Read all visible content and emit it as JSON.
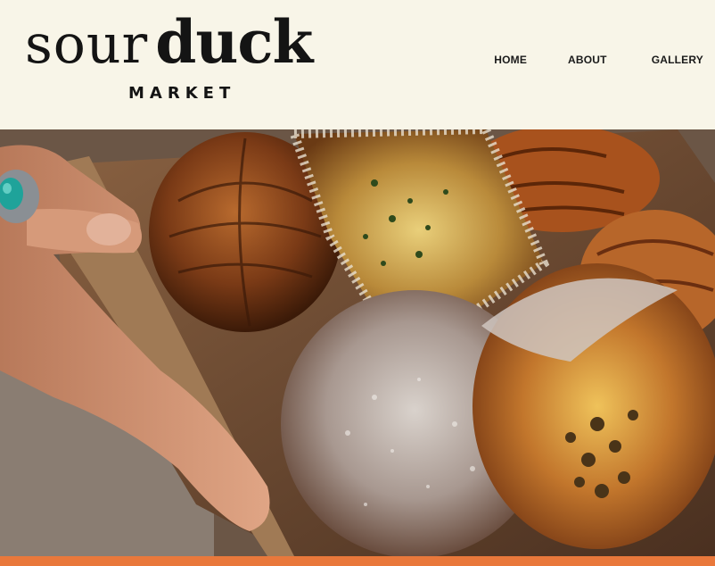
{
  "brand": {
    "name_light": "sour",
    "name_bold": "duck",
    "tagline": "MARKET"
  },
  "nav": {
    "items": [
      "HOME",
      "ABOUT",
      "GALLERY"
    ]
  },
  "hero": {
    "image": "pastries-in-box-photo"
  },
  "colors": {
    "background": "#f8f5e8",
    "text": "#141414",
    "accent_band": "#e9783b"
  }
}
